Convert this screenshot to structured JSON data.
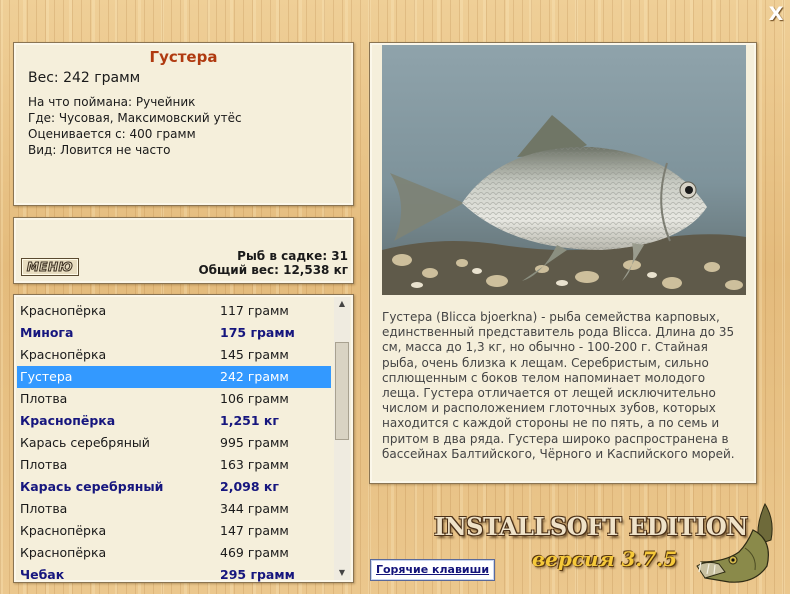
{
  "window": {
    "close_label": "X"
  },
  "info": {
    "title": "Густера",
    "weight": "Вес: 242 грамм",
    "caught_on": "На что поймана: Ручейник",
    "location": "Где: Чусовая, Максимовский утёс",
    "valued_from": "Оценивается с: 400 грамм",
    "frequency": "Вид: Ловится не часто"
  },
  "menu": {
    "menu_label": "МЕНЮ",
    "fish_count": "Рыб в садке: 31",
    "total_weight": "Общий вес: 12,538 кг"
  },
  "catch_list": {
    "selected_index": 3,
    "rows": [
      {
        "name": "Краснопёрка",
        "weight": "117 грамм",
        "big": false
      },
      {
        "name": "Минога",
        "weight": "175 грамм",
        "big": true
      },
      {
        "name": "Краснопёрка",
        "weight": "145 грамм",
        "big": false
      },
      {
        "name": "Густера",
        "weight": "242 грамм",
        "big": false
      },
      {
        "name": "Плотва",
        "weight": "106 грамм",
        "big": false
      },
      {
        "name": "Краснопёрка",
        "weight": "1,251 кг",
        "big": true
      },
      {
        "name": "Карась серебряный",
        "weight": "995 грамм",
        "big": false
      },
      {
        "name": "Плотва",
        "weight": "163 грамм",
        "big": false
      },
      {
        "name": "Карась серебряный",
        "weight": "2,098 кг",
        "big": true
      },
      {
        "name": "Плотва",
        "weight": "344 грамм",
        "big": false
      },
      {
        "name": "Краснопёрка",
        "weight": "147 грамм",
        "big": false
      },
      {
        "name": "Краснопёрка",
        "weight": "469 грамм",
        "big": false
      },
      {
        "name": "Чебак",
        "weight": "295 грамм",
        "big": true
      }
    ]
  },
  "description": {
    "text": "Густера (Blicca bjoerkna) - рыба семейства карповых, единственный представитель рода Blicca. Длина до 35 см, масса до 1,3 кг, но обычно - 100-200 г. Стайная рыба, очень близка к лещам. Серебристым, сильно сплющенным с боков телом напоминает молодого леща. Густера отличается от лещей исключительно числом и расположением глоточных зубов, которых находится с каждой стороны не по пять, а по семь и притом в два ряда. Густера широко распространена в бассейнах Балтийского, Чёрного и Каспийского морей."
  },
  "footer": {
    "hotkeys_label": "Горячие клавиши",
    "edition": "INSTALLSOFT EDITION",
    "version": "версия 3.7.5"
  },
  "colors": {
    "accent_title": "#b03a10",
    "big_fish": "#16167e",
    "selection": "#3399ff"
  }
}
